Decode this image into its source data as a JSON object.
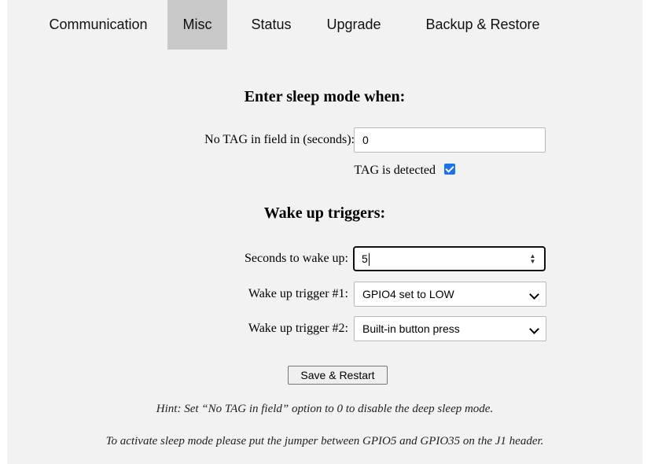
{
  "tabs": [
    {
      "label": "Communication",
      "active": false
    },
    {
      "label": "Misc",
      "active": true
    },
    {
      "label": "Status",
      "active": false
    },
    {
      "label": "Upgrade",
      "active": false
    },
    {
      "label": "Backup & Restore",
      "active": false
    }
  ],
  "sleep": {
    "heading": "Enter sleep mode when:",
    "no_tag_label": "No TAG in field in (seconds):",
    "no_tag_value": "0",
    "tag_detected_label": "TAG is detected",
    "tag_detected_checked": true
  },
  "wake": {
    "heading": "Wake up triggers:",
    "seconds_label": "Seconds to wake up:",
    "seconds_value": "5",
    "trigger1_label": "Wake up trigger #1:",
    "trigger1_value": "GPIO4 set to LOW",
    "trigger2_label": "Wake up trigger #2:",
    "trigger2_value": "Built-in button press"
  },
  "save_button": "Save & Restart",
  "hints": {
    "hint1": "Hint: Set “No TAG in field” option to 0 to disable the deep sleep mode.",
    "hint2": "To activate sleep mode please put the jumper between GPIO5 and GPIO35 on the J1 header."
  },
  "colors": {
    "panel": "#f2f2f2",
    "active_tab": "#c8c8c8",
    "checkbox": "#1a73e8"
  }
}
